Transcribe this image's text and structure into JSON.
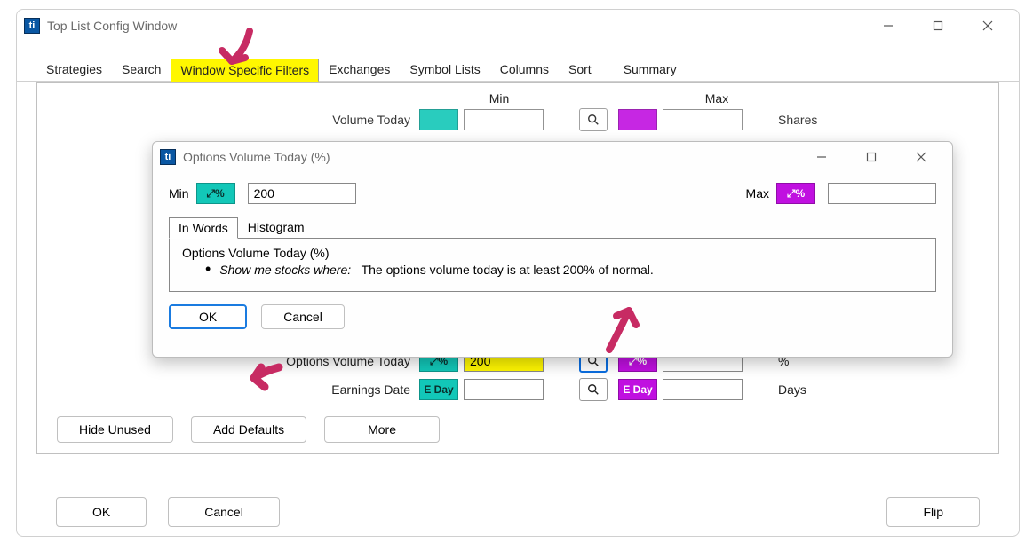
{
  "window": {
    "title": "Top List Config Window",
    "app_icon_text": "ti",
    "tabs": [
      "Strategies",
      "Search",
      "Window Specific Filters",
      "Exchanges",
      "Symbol Lists",
      "Columns",
      "Sort",
      "Summary"
    ],
    "highlighted_tab_index": 2,
    "columns": {
      "min": "Min",
      "max": "Max"
    }
  },
  "filters": {
    "volume_today": {
      "label": "Volume Today",
      "pill_text": "",
      "min": "",
      "max": "",
      "unit": "Shares"
    },
    "options_volume_today": {
      "label": "Options Volume Today",
      "pill_text": "⤢%",
      "min": "200",
      "max": "",
      "unit": "%"
    },
    "earnings_date": {
      "label": "Earnings Date",
      "pill_text": "E Day",
      "min": "",
      "max": "",
      "unit": "Days"
    }
  },
  "dialog": {
    "title": "Options Volume Today (%)",
    "min_label": "Min",
    "max_label": "Max",
    "pill_text": "⤢%",
    "min_value": "200",
    "max_value": "",
    "tabs": {
      "words": "In Words",
      "hist": "Histogram"
    },
    "heading": "Options Volume Today (%)",
    "lead": "Show me stocks where:",
    "sentence": "The options volume today is at least 200% of normal.",
    "ok": "OK",
    "cancel": "Cancel"
  },
  "buttons": {
    "hide_unused": "Hide Unused",
    "add_defaults": "Add Defaults",
    "more": "More",
    "ok": "OK",
    "cancel": "Cancel",
    "flip": "Flip"
  }
}
